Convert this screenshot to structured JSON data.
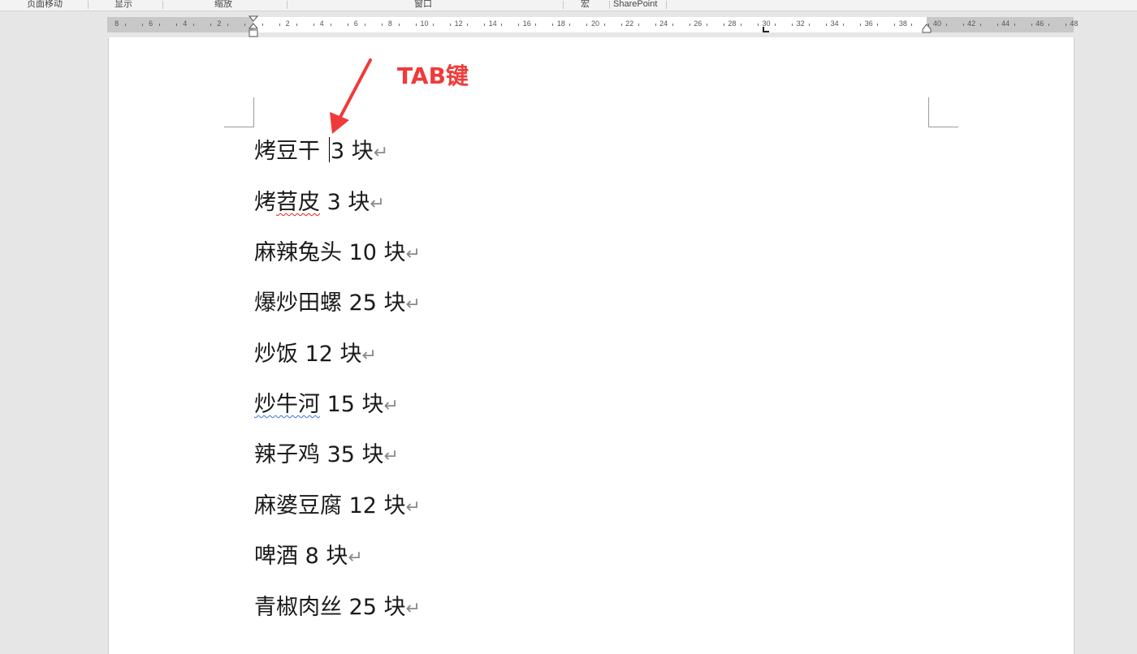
{
  "ribbon_groups": [
    {
      "label": "页面移动"
    },
    {
      "label": "显示"
    },
    {
      "label": "缩放"
    },
    {
      "label": "窗口"
    },
    {
      "label": "宏"
    },
    {
      "label": "SharePoint"
    }
  ],
  "ruler": {
    "left_numbers": [
      "8",
      "6",
      "4",
      "2"
    ],
    "right_numbers": [
      "2",
      "4",
      "6",
      "8",
      "10",
      "12",
      "14",
      "16",
      "18",
      "20",
      "22",
      "24",
      "26",
      "28",
      "30",
      "32",
      "34",
      "36",
      "38",
      "40",
      "42",
      "44",
      "46",
      "48"
    ]
  },
  "annotation": {
    "text": "TAB键",
    "color": "#f03a3a"
  },
  "document": {
    "lines": [
      {
        "item": "烤豆干",
        "price": "3 块"
      },
      {
        "item": "烤苕皮",
        "price": "3 块"
      },
      {
        "item": "麻辣兔头",
        "price": "10 块"
      },
      {
        "item": "爆炒田螺",
        "price": "25 块"
      },
      {
        "item": "炒饭",
        "price": "12 块"
      },
      {
        "item": "炒牛河",
        "price": "15 块"
      },
      {
        "item": "辣子鸡",
        "price": "35 块"
      },
      {
        "item": "麻婆豆腐",
        "price": "12 块"
      },
      {
        "item": "啤酒",
        "price": "8 块"
      },
      {
        "item": "青椒肉丝",
        "price": "25 块"
      }
    ],
    "paragraph_mark": "↵"
  }
}
